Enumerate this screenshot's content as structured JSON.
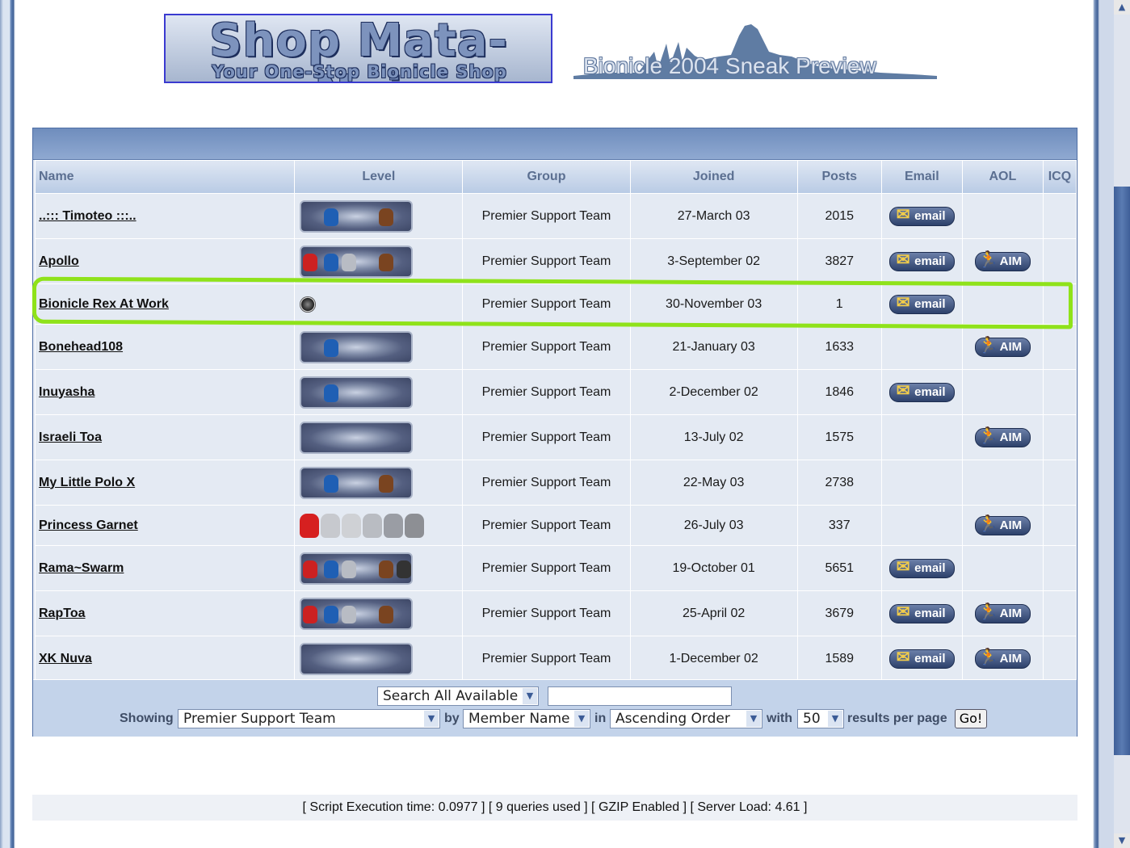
{
  "banner": {
    "logo_main": "Shop Mata-Nui",
    "logo_sub": "Your One-Stop Bionicle Shop",
    "preview_text": "Bionicle 2004 Sneak Preview"
  },
  "table": {
    "headers": {
      "name": "Name",
      "level": "Level",
      "group": "Group",
      "joined": "Joined",
      "posts": "Posts",
      "email": "Email",
      "aol": "AOL",
      "icq": "ICQ"
    },
    "rows": [
      {
        "name": "..::: Timoteo :::..",
        "group": "Premier Support Team",
        "joined": "27-March 03",
        "posts": "2015",
        "email": "email",
        "aim": ""
      },
      {
        "name": "Apollo",
        "group": "Premier Support Team",
        "joined": "3-September 02",
        "posts": "3827",
        "email": "email",
        "aim": "AIM"
      },
      {
        "name": "Bionicle Rex At Work",
        "group": "Premier Support Team",
        "joined": "30-November 03",
        "posts": "1",
        "email": "email",
        "aim": ""
      },
      {
        "name": "Bonehead108",
        "group": "Premier Support Team",
        "joined": "21-January 03",
        "posts": "1633",
        "email": "",
        "aim": "AIM"
      },
      {
        "name": "Inuyasha",
        "group": "Premier Support Team",
        "joined": "2-December 02",
        "posts": "1846",
        "email": "email",
        "aim": ""
      },
      {
        "name": "Israeli Toa",
        "group": "Premier Support Team",
        "joined": "13-July 02",
        "posts": "1575",
        "email": "",
        "aim": "AIM"
      },
      {
        "name": "My Little Polo X",
        "group": "Premier Support Team",
        "joined": "22-May 03",
        "posts": "2738",
        "email": "",
        "aim": ""
      },
      {
        "name": "Princess Garnet",
        "group": "Premier Support Team",
        "joined": "26-July 03",
        "posts": "337",
        "email": "",
        "aim": "AIM"
      },
      {
        "name": "Rama~Swarm",
        "group": "Premier Support Team",
        "joined": "19-October 01",
        "posts": "5651",
        "email": "email",
        "aim": ""
      },
      {
        "name": "RapToa",
        "group": "Premier Support Team",
        "joined": "25-April 02",
        "posts": "3679",
        "email": "email",
        "aim": "AIM"
      },
      {
        "name": "XK Nuva",
        "group": "Premier Support Team",
        "joined": "1-December 02",
        "posts": "1589",
        "email": "email",
        "aim": "AIM"
      }
    ]
  },
  "footer": {
    "search_select": "Search All Available",
    "search_value": "",
    "showing_label": "Showing",
    "group_select": "Premier Support Team",
    "by_label": "by",
    "sort_select": "Member Name",
    "in_label": "in",
    "order_select": "Ascending Order",
    "with_label": "with",
    "count_select": "50",
    "results_label": "results per page",
    "go_label": "Go!"
  },
  "stats": "[ Script Execution time: 0.0977 ]   [ 9 queries used ]   [ GZIP Enabled ]   [ Server Load: 4.61 ]",
  "colors": {
    "highlight": "#8fe21a",
    "header_bar": "#6f8dbd",
    "row_bg": "#e4eaf3"
  }
}
